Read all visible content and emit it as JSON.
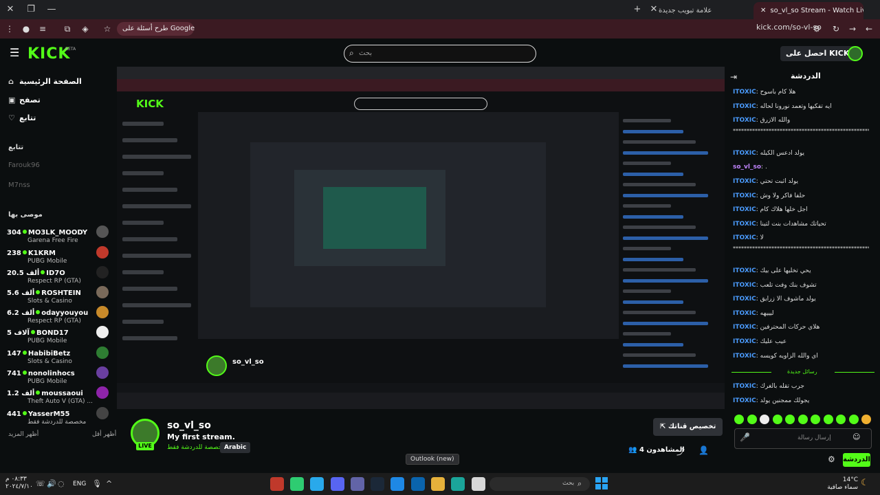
{
  "browser": {
    "active_tab_title": "so_vl_so Stream - Watch Live o",
    "second_tab_title": "علامة تبويب جديدة",
    "omnibox_chip": "طرح أسئلة على Google",
    "url": "kick.com/so-vl-so"
  },
  "header": {
    "logo": "KICK",
    "beta": "BETA",
    "search_placeholder": "بحث",
    "get_kicks_label": "احصل على KICKs"
  },
  "sidebar": {
    "nav": [
      {
        "label": "الصفحة الرئيسية",
        "icon": "home-icon"
      },
      {
        "label": "تصفح",
        "icon": "browse-icon"
      },
      {
        "label": "تتابع",
        "icon": "heart-icon"
      }
    ],
    "following_title": "تتابع",
    "following": [
      {
        "name": "Farouk96"
      },
      {
        "name": "M7nss"
      }
    ],
    "recommended_title": "موصى بها",
    "recommended": [
      {
        "count": "304",
        "name": "MO3LK_MOODY",
        "category": "Garena Free Fire",
        "color": "#555"
      },
      {
        "count": "238",
        "name": "K1KRM",
        "category": "PUBG Mobile",
        "color": "#c0392b"
      },
      {
        "count": "20.5 ألف",
        "name": "ID7O",
        "category": "Respect RP (GTA)",
        "color": "#222"
      },
      {
        "count": "5.6 ألف",
        "name": "ROSHTEIN",
        "category": "Slots & Casino",
        "color": "#7a6a5a"
      },
      {
        "count": "6.2 ألف",
        "name": "odayyouyou",
        "category": "Respect RP (GTA)",
        "color": "#c88a2a"
      },
      {
        "count": "5 آلاف",
        "name": "BOND17",
        "category": "PUBG Mobile",
        "color": "#eee"
      },
      {
        "count": "147",
        "name": "HabibiBetz",
        "category": "Slots & Casino",
        "color": "#2e7d32"
      },
      {
        "count": "741",
        "name": "nonolinhocs",
        "category": "PUBG Mobile",
        "color": "#6a3fa0"
      },
      {
        "count": "1.2 ألف",
        "name": "moussaoui",
        "category": "Theft Auto V (GTA) ...",
        "color": "#8e24aa"
      },
      {
        "count": "441",
        "name": "YasserM55",
        "category": "مخصصة للدردشة فقط",
        "color": "#444"
      }
    ],
    "show_more": "أظهر المزيد",
    "show_less": "أظهر أقل"
  },
  "channel": {
    "name": "so_vl_so",
    "stream_title": "My first stream.",
    "category": "مخصصة للدردشة فقط",
    "language": "Arabic",
    "live_label": "LIVE",
    "customize_label": "تخصيص قناتك",
    "viewers_label": "المشاهدون 4"
  },
  "tooltip": "Outlook (new)",
  "chat": {
    "title": "الدردشة",
    "messages": [
      {
        "user": "ITOXIC",
        "text": "هلا كام باسوح"
      },
      {
        "user": "ITOXIC",
        "text": "ايه تفكيها وتعمد نورونا لحاله"
      },
      {
        "user": "ITOXIC",
        "text": "والله الازرق"
      },
      {
        "user": "",
        "text": "**************************************************"
      },
      {
        "user": "ITOXIC",
        "text": "يولد ادعس الكيله"
      },
      {
        "user": "so_vl_so",
        "text": "."
      },
      {
        "user": "ITOXIC",
        "text": "يولد اثبت تحتي"
      },
      {
        "user": "ITOXIC",
        "text": "حلفا فاكر ولا وش"
      },
      {
        "user": "ITOXIC",
        "text": "اجل خلها هلاك كام"
      },
      {
        "user": "ITOXIC",
        "text": "تحياتك مشاهدات بنت لتينا"
      },
      {
        "user": "ITOXIC",
        "text": "لا"
      },
      {
        "user": "",
        "text": "**************************************************"
      },
      {
        "user": "ITOXIC",
        "text": "يحي تخليها على بيك"
      },
      {
        "user": "ITOXIC",
        "text": "تشوف بنك وفت تلعب"
      },
      {
        "user": "ITOXIC",
        "text": "يولد ماشوف الا زرايق"
      },
      {
        "user": "ITOXIC",
        "text": "ليييهه"
      },
      {
        "user": "ITOXIC",
        "text": "هلاي حركات المحترفين"
      },
      {
        "user": "ITOXIC",
        "text": "عيب عليك"
      },
      {
        "user": "ITOXIC",
        "text": "اي والله الزاويه كويسه"
      }
    ],
    "new_messages_label": "رسائل جديدة",
    "after_messages": [
      {
        "user": "ITOXIC",
        "text": "جرب تقله بالغرك"
      },
      {
        "user": "ITOXIC",
        "text": "يجولك ممجنين يولد"
      }
    ],
    "input_placeholder": "إرسال رسالة",
    "send_label": "الدردشة"
  },
  "taskbar": {
    "time": "٠٨:٣٣ م",
    "date": "٢٠٢٤/٧/١٠",
    "lang": "ENG",
    "search_placeholder": "بحث",
    "temperature": "14°C",
    "weather": "سماء صافية"
  },
  "colors": {
    "kick_green": "#53fc18",
    "chat_user": "#4b9cff",
    "browser_accent": "#3b1a22"
  }
}
